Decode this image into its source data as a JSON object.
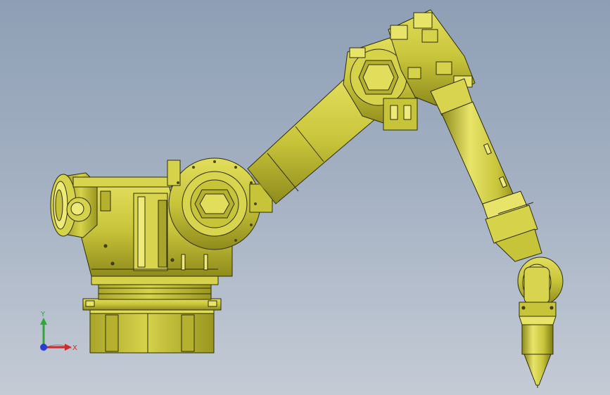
{
  "viewport": {
    "background_top": "#8e9fb5",
    "background_bottom": "#c4cbd5",
    "model_color": "#c8c43a",
    "model_shadow": "#8f8b1c",
    "model_highlight": "#eeea7a",
    "edge_color": "#2e2e0c"
  },
  "triad": {
    "y_label": "Y",
    "x_label": "X",
    "y_color": "#2fa83a",
    "x_color": "#d62828",
    "z_color": "#2a3bd6"
  }
}
